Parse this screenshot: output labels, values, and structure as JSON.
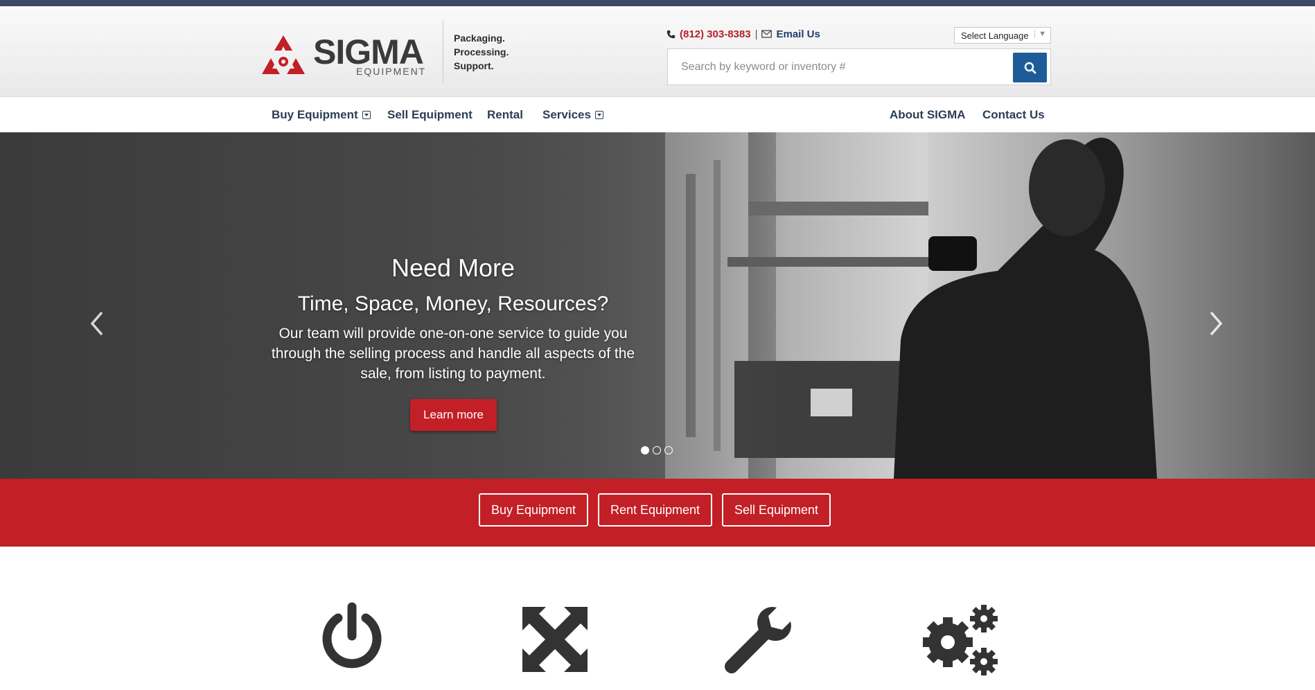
{
  "header": {
    "logo_word": "SIGMA",
    "logo_sub": "EQUIPMENT",
    "tagline": [
      "Packaging.",
      "Processing.",
      "Support."
    ],
    "phone": "(812) 303-8383",
    "separator": "|",
    "email_label": "Email Us",
    "language_label": "Select Language",
    "search_placeholder": "Search by keyword or inventory #"
  },
  "nav": {
    "left": [
      "Buy Equipment",
      "Sell Equipment",
      "Rental",
      "Services"
    ],
    "right": [
      "About SIGMA",
      "Contact Us"
    ]
  },
  "hero": {
    "title": "Need More",
    "subtitle": "Time, Space, Money, Resources?",
    "text": "Our team will provide one-on-one service to guide you through the selling process and handle all aspects of the sale, from listing to payment.",
    "button": "Learn more",
    "active_slide": 1,
    "slide_count": 3
  },
  "cta": {
    "buttons": [
      "Buy Equipment",
      "Rent Equipment",
      "Sell Equipment"
    ]
  },
  "features": {
    "icons": [
      "power-icon",
      "expand-arrows-icon",
      "wrench-icon",
      "gears-icon"
    ]
  },
  "colors": {
    "brand_red": "#c21f26",
    "navy": "#2c3e56",
    "search_blue": "#1d5c99",
    "top_bar": "#3b4a63"
  }
}
